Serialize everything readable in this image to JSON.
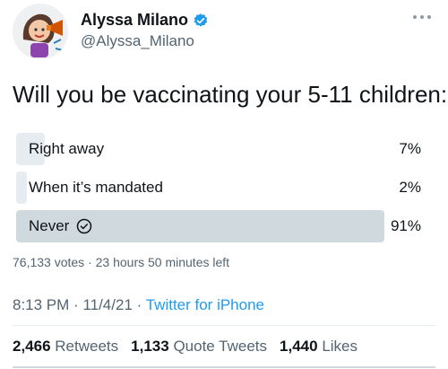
{
  "tweet": {
    "author": {
      "display_name": "Alyssa Milano",
      "handle": "@Alyssa_Milano",
      "verified": true,
      "avatar_icon": "cartoon-avatar-icon"
    },
    "question": "Will you be vaccinating your 5-11 children:",
    "poll": {
      "options": [
        {
          "label": "Right away",
          "percent": 7,
          "percent_label": "7%",
          "winner": false
        },
        {
          "label": "When it’s mandated",
          "percent": 2,
          "percent_label": "2%",
          "winner": false
        },
        {
          "label": "Never",
          "percent": 91,
          "percent_label": "91%",
          "winner": true
        }
      ],
      "votes": "76,133 votes",
      "time_left": "23 hours 50 minutes left"
    },
    "time": "8:13 PM",
    "date": "11/4/21",
    "source": "Twitter for iPhone",
    "stats": {
      "retweets_count": "2,466",
      "retweets_label": "Retweets",
      "quote_count": "1,133",
      "quote_label": "Quote Tweets",
      "likes_count": "1,440",
      "likes_label": "Likes"
    }
  },
  "colors": {
    "winner_bar": "#cfd9de",
    "loser_bar": "#e6ecf0",
    "link": "#1d9bf0",
    "verified": "#1d9bf0",
    "muted_text": "#536471"
  }
}
